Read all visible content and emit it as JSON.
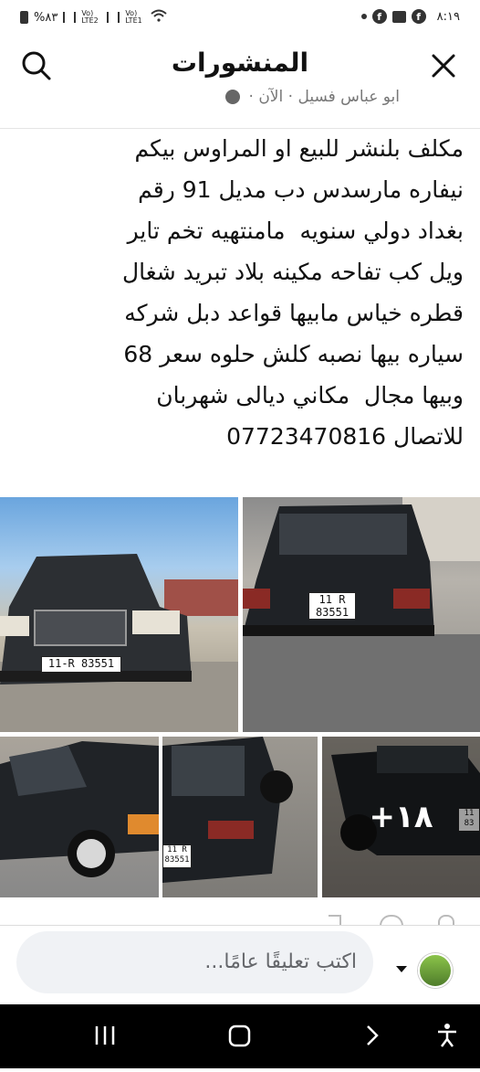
{
  "status_bar": {
    "battery": "%٨٣",
    "carrier1": "Vo) LTE2",
    "carrier2": "Vo) LTE1",
    "time": "٨:١٩"
  },
  "header": {
    "title": "المنشورات"
  },
  "post": {
    "author": "ابو عباس فسيل",
    "time": "· الآن ·",
    "text": "مكلف بلنشر للبيع او المراوس بيكم\nنيفاره مارسدس دب مديل 91 رقم\nبغداد دولي سنويه  مامنتهيه تخم تاير\nويل كب تفاحه مكينه بلاد تبريد شغال\nقطره خياس مابيها قواعد دبل شركه\nسياره بيها نصبه كلش حلوه سعر 68\nوبيها مجال  مكاني ديالى شهربان\nللاتصال 07723470816",
    "photos": [
      {
        "plate": "11-R 83551"
      },
      {
        "plate_top": "11  R",
        "plate_bottom": "83551"
      },
      {},
      {
        "plate": "11 R 83551"
      },
      {
        "plate": "11 83"
      }
    ],
    "more_photos": "+١٨"
  },
  "comment_bar": {
    "placeholder": "اكتب تعليقًا عامًا..."
  },
  "colors": {
    "nav_bg": "#000000",
    "input_bg": "#f0f2f5"
  }
}
